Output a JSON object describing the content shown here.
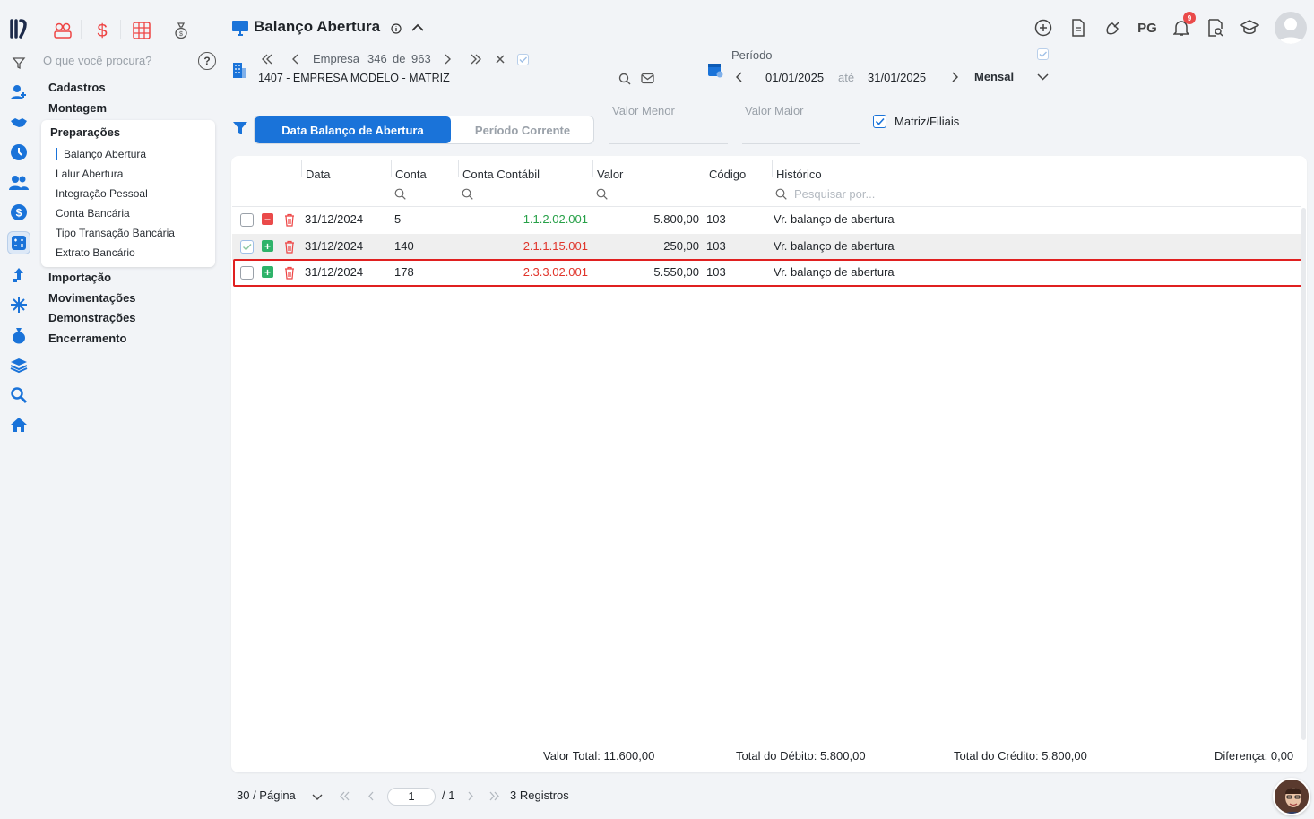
{
  "sidebar": {
    "search_placeholder": "O que você procura?",
    "help_label": "?",
    "menu": {
      "cadastros": "Cadastros",
      "montagem": "Montagem",
      "preparacoes": "Preparações",
      "importacao": "Importação",
      "movimentacoes": "Movimentações",
      "demonstracoes": "Demonstrações",
      "encerramento": "Encerramento"
    },
    "submenu": [
      "Balanço Abertura",
      "Lalur Abertura",
      "Integração Pessoal",
      "Conta Bancária",
      "Tipo Transação Bancária",
      "Extrato Bancário"
    ]
  },
  "header": {
    "title": "Balanço Abertura",
    "pg_label": "PG",
    "notification_count": "9"
  },
  "empresa": {
    "nav_label": "Empresa",
    "current": "346",
    "of": "de",
    "total": "963",
    "name": "1407 - EMPRESA MODELO - MATRIZ"
  },
  "periodo": {
    "label": "Período",
    "start": "01/01/2025",
    "ate": "até",
    "end": "31/01/2025",
    "frequency": "Mensal"
  },
  "filters": {
    "tab_active": "Data Balanço de Abertura",
    "tab_inactive": "Período Corrente",
    "valor_menor": "Valor Menor",
    "valor_maior": "Valor Maior",
    "matriz_filiais": "Matriz/Filiais"
  },
  "table": {
    "columns": [
      "Data",
      "Conta",
      "Conta Contábil",
      "Valor",
      "Código",
      "Histórico"
    ],
    "historico_search_placeholder": "Pesquisar por...",
    "rows": [
      {
        "sign": "−",
        "data": "31/12/2024",
        "conta": "5",
        "conta_contabil": "1.1.2.02.001",
        "valor": "5.800,00",
        "codigo": "103",
        "historico": "Vr. balanço de abertura"
      },
      {
        "sign": "+",
        "data": "31/12/2024",
        "conta": "140",
        "conta_contabil": "2.1.1.15.001",
        "valor": "250,00",
        "codigo": "103",
        "historico": "Vr. balanço de abertura"
      },
      {
        "sign": "+",
        "data": "31/12/2024",
        "conta": "178",
        "conta_contabil": "2.3.3.02.001",
        "valor": "5.550,00",
        "codigo": "103",
        "historico": "Vr. balanço de abertura"
      }
    ]
  },
  "totals": {
    "valor_total": "Valor Total: 11.600,00",
    "total_debito": "Total do Débito: 5.800,00",
    "total_credito": "Total do Crédito: 5.800,00",
    "diferenca": "Diferença: 0,00"
  },
  "pagination": {
    "per_page": "30 / Página",
    "current_page": "1",
    "total_pages": "/ 1",
    "records": "3 Registros"
  },
  "colors": {
    "accent": "#1a73d9",
    "debit": "#27a048",
    "credit": "#e0352b",
    "highlight": "#e02020"
  }
}
